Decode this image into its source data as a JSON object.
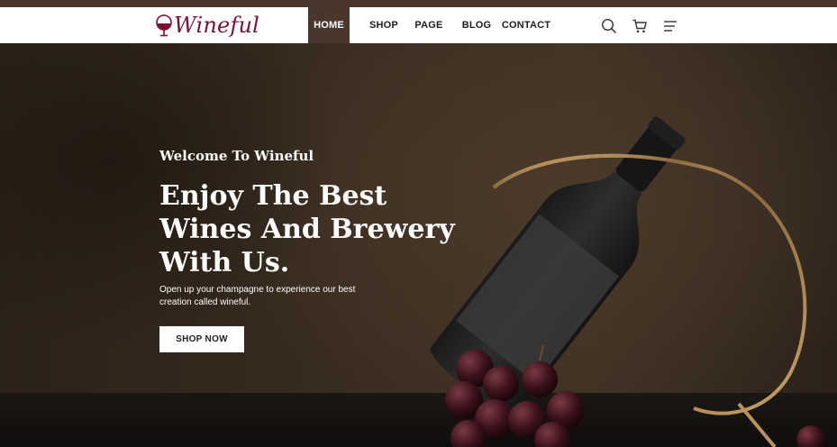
{
  "brand": {
    "name": "Wineful",
    "logo_icon": "wine-glass-icon",
    "color": "#7a1230"
  },
  "nav": {
    "items": [
      {
        "label": "HOME",
        "active": true
      },
      {
        "label": "SHOP",
        "active": false
      },
      {
        "label": "PAGE",
        "active": false
      },
      {
        "label": "BLOG",
        "active": false
      },
      {
        "label": "CONTACT",
        "active": false
      }
    ],
    "icons": [
      "search-icon",
      "cart-icon",
      "menu-icon"
    ],
    "active_color": "#4a372c"
  },
  "hero": {
    "eyebrow": "Welcome To Wineful",
    "headline_lines": [
      "Enjoy The Best",
      "Wines And Brewery",
      "With Us."
    ],
    "subtext_lines": [
      "Open up your champagne to experience our best",
      "creation called wineful."
    ],
    "cta_label": "SHOP NOW"
  }
}
